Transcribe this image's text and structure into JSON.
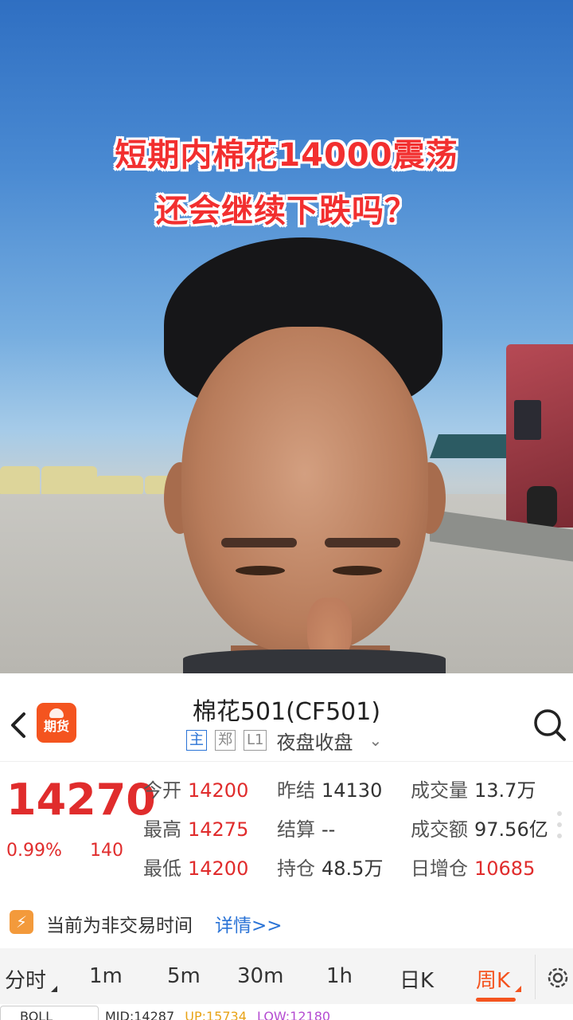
{
  "video": {
    "caption_line1": "短期内棉花14000震荡",
    "caption_line2": "还会继续下跌吗？"
  },
  "header": {
    "back_icon": "chevron-left-icon",
    "app_logo_text": "期货",
    "title": "棉花501(CF501)",
    "tags": [
      "主",
      "郑",
      "L1"
    ],
    "session": "夜盘收盘",
    "search_icon": "search-icon"
  },
  "quote": {
    "price": "14270",
    "change_pct": "0.99%",
    "change": "140",
    "stats": [
      {
        "label": "今开",
        "value": "14200",
        "color": "red"
      },
      {
        "label": "昨结",
        "value": "14130",
        "color": "dark"
      },
      {
        "label": "成交量",
        "value": "13.7万",
        "color": "dark"
      },
      {
        "label": "最高",
        "value": "14275",
        "color": "red"
      },
      {
        "label": "结算",
        "value": "--",
        "color": "dark"
      },
      {
        "label": "成交额",
        "value": "97.56亿",
        "color": "dark"
      },
      {
        "label": "最低",
        "value": "14200",
        "color": "red"
      },
      {
        "label": "持仓",
        "value": "48.5万",
        "color": "dark"
      },
      {
        "label": "日增仓",
        "value": "10685",
        "color": "red"
      }
    ]
  },
  "notice": {
    "text": "当前为非交易时间",
    "link": "详情>>"
  },
  "tabs": [
    "分时",
    "1m",
    "5m",
    "30m",
    "1h",
    "日K",
    "周K"
  ],
  "active_tab": "周K",
  "indicator": {
    "name": "BOLL",
    "mid": "MID:14287",
    "up": "UP:15734",
    "low": "LOW:12180"
  },
  "colors": {
    "accent": "#f4541f",
    "up_red": "#e02c2c",
    "link_blue": "#2a73d6"
  }
}
